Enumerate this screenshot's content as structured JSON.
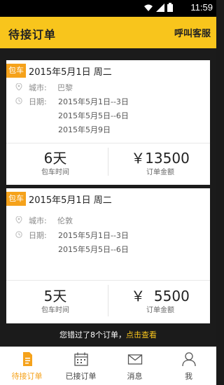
{
  "status": {
    "time": "11:59"
  },
  "header": {
    "title": "待接订单",
    "action_label": "呼叫客服"
  },
  "orders": [
    {
      "tag": "包车",
      "date_title": "2015年5月1日  周二",
      "city_label": "城市:",
      "city": "巴黎",
      "date_label": "日期:",
      "dates": [
        "2015年5月1日--3日",
        "2015年5月5日--6日",
        "2015年5月9日"
      ],
      "duration": "6天",
      "duration_label": "包车时间",
      "amount": "￥13500",
      "amount_label": "订单金额"
    },
    {
      "tag": "包车",
      "date_title": "2015年5月1日  周二",
      "city_label": "城市:",
      "city": "伦敦",
      "date_label": "日期:",
      "dates": [
        "2015年5月1日--3日",
        "2015年5月5日--6日"
      ],
      "duration": "5天",
      "duration_label": "包车时间",
      "amount": "￥  5500",
      "amount_label": "订单金额"
    }
  ],
  "notice": {
    "text": "您错过了8个订单，",
    "link": "点击查看"
  },
  "tabs": [
    {
      "label": "待接订单",
      "icon": "document-icon",
      "active": true
    },
    {
      "label": "已接订单",
      "icon": "calendar-icon",
      "active": false
    },
    {
      "label": "消息",
      "icon": "mail-icon",
      "active": false
    },
    {
      "label": "我",
      "icon": "person-icon",
      "active": false
    }
  ],
  "colors": {
    "accent": "#f8c51c",
    "tag": "#f5a21b",
    "background": "#1b1b1b"
  }
}
